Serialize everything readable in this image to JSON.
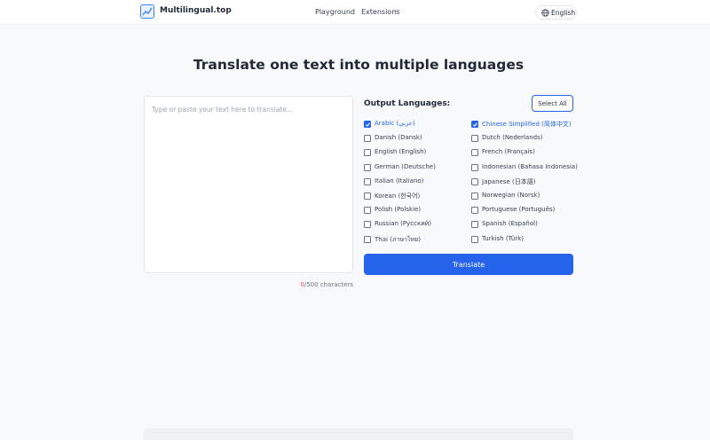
{
  "header": {
    "logo_text": "Multilingual.top",
    "nav": {
      "playground": "Playground",
      "extensions": "Extensions"
    },
    "language_button": "English"
  },
  "main": {
    "title": "Translate one text into multiple languages",
    "input": {
      "value": "",
      "placeholder": "Type or paste your text here to translate...",
      "char_used": "0",
      "char_suffix": "/500 characters"
    },
    "output": {
      "label": "Output Languages:",
      "select_all": "Select All",
      "languages": [
        {
          "label": "Arabic (عربي)",
          "checked": true
        },
        {
          "label": "Chinese Simplified (简体中文)",
          "checked": true
        },
        {
          "label": "Danish (Dansk)",
          "checked": false
        },
        {
          "label": "Dutch (Nederlands)",
          "checked": false
        },
        {
          "label": "English (English)",
          "checked": false
        },
        {
          "label": "French (Français)",
          "checked": false
        },
        {
          "label": "German (Deutsche)",
          "checked": false
        },
        {
          "label": "Indonesian (Bahasa Indonesia)",
          "checked": false
        },
        {
          "label": "Italian (Italiano)",
          "checked": false
        },
        {
          "label": "Japanese (日本語)",
          "checked": false
        },
        {
          "label": "Korean (한국어)",
          "checked": false
        },
        {
          "label": "Norwegian (Norsk)",
          "checked": false
        },
        {
          "label": "Polish (Polskie)",
          "checked": false
        },
        {
          "label": "Portuguese (Português)",
          "checked": false
        },
        {
          "label": "Russian (Русский)",
          "checked": false
        },
        {
          "label": "Spanish (Español)",
          "checked": false
        },
        {
          "label": "Thai (ภาษาไทย)",
          "checked": false
        },
        {
          "label": "Turkish (Türk)",
          "checked": false
        }
      ],
      "translate_button": "Translate"
    }
  },
  "colors": {
    "accent": "#2563eb",
    "counter_used": "#ef4444"
  },
  "icons": {
    "logo": "chart-line-icon",
    "extensions_chevron": "chevron-down-icon",
    "language": "globe-icon",
    "checkbox_checked": "check-icon"
  }
}
